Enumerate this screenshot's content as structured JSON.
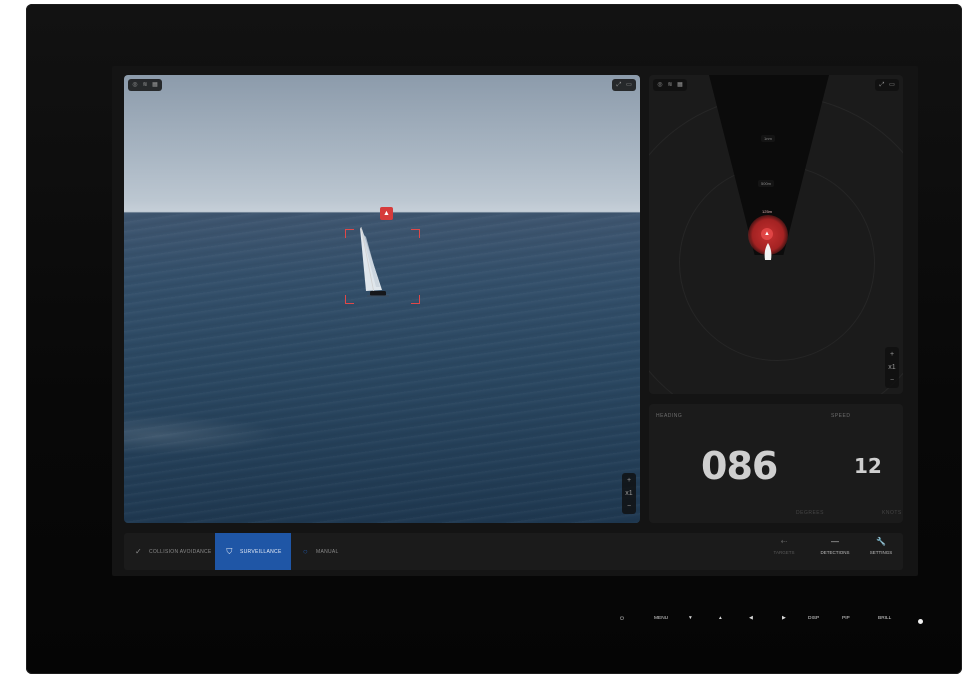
{
  "camera": {
    "target_marker_icon": "warning-triangle-icon",
    "topleft_icons": [
      "target-icon",
      "layers-icon",
      "grid-icon"
    ],
    "topright_icons": [
      "expand-icon",
      "video-icon"
    ],
    "zoom": {
      "plus": "+",
      "level": "x1",
      "minus": "−"
    }
  },
  "radar": {
    "topleft_icons": [
      "target-icon",
      "layers-icon",
      "grid-icon"
    ],
    "topright_icons": [
      "expand-icon",
      "video-icon"
    ],
    "ranges": [
      "1nm",
      "500m"
    ],
    "target_label": "125m",
    "zoom": {
      "plus": "+",
      "level": "x1",
      "minus": "−"
    }
  },
  "nav": {
    "heading_label": "HEADING",
    "speed_label": "SPEED",
    "heading_value": "086",
    "speed_value": "12",
    "heading_unit": "DEGREES",
    "speed_unit": "KNOTS"
  },
  "modes": [
    {
      "label": "COLLISION AVOIDANCE",
      "icon": "check-circle-icon",
      "active": false
    },
    {
      "label": "SURVEILLANCE",
      "icon": "shield-icon",
      "active": true
    },
    {
      "label": "MANUAL",
      "icon": "circle-icon",
      "active": false
    }
  ],
  "tools": [
    {
      "label": "TARGETS",
      "icon": "targets-icon",
      "disabled": true
    },
    {
      "label": "DETECTIONS",
      "icon": "detections-icon",
      "disabled": false
    },
    {
      "label": "SETTINGS",
      "icon": "wrench-icon",
      "disabled": false
    }
  ],
  "hardware_buttons": {
    "power": "⏻",
    "menu": "MENU",
    "down": "▼",
    "up": "▲",
    "left": "◀",
    "right": "▶",
    "disp": "DISP",
    "pip": "PIP",
    "brill": "BRILL"
  },
  "colors": {
    "accent": "#1f56a6",
    "alert": "#d63b3b",
    "panel": "#1b1b1b"
  }
}
